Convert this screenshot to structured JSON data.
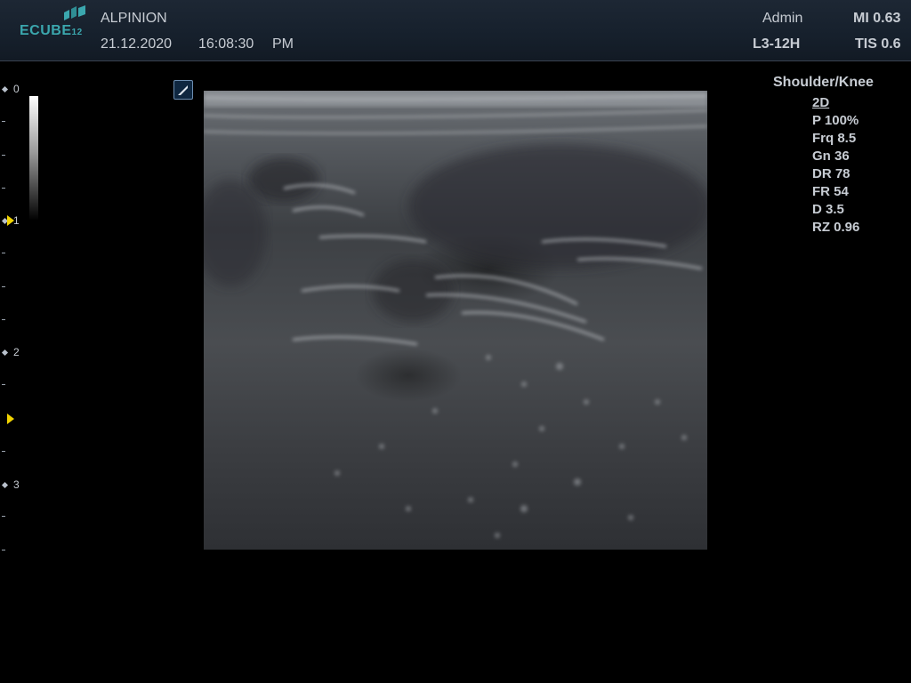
{
  "header": {
    "logo_text": "ECUBE",
    "logo_suffix": "12",
    "manufacturer": "ALPINION",
    "date": "21.12.2020",
    "time": "16:08:30",
    "ampm": "PM",
    "user": "Admin",
    "probe": "L3-12H",
    "mi": "MI 0.63",
    "tis": "TIS 0.6"
  },
  "depth_scale": {
    "labels": [
      "0",
      "1",
      "2",
      "3"
    ]
  },
  "preset": "Shoulder/Knee",
  "params": {
    "mode": "2D",
    "power": "P 100%",
    "frequency": "Frq 8.5",
    "gain": "Gn 36",
    "dynamic_range": "DR 78",
    "frame_rate": "FR 54",
    "depth": "D 3.5",
    "zoom": "RZ 0.96"
  },
  "colors": {
    "accent": "#3ba7ae",
    "focus_marker": "#f2d400",
    "text": "#c7ccd3",
    "header_bg": "#1d2734"
  },
  "icons": {
    "orientation": "probe-orientation-icon",
    "logo": "ecube-logo-icon"
  }
}
